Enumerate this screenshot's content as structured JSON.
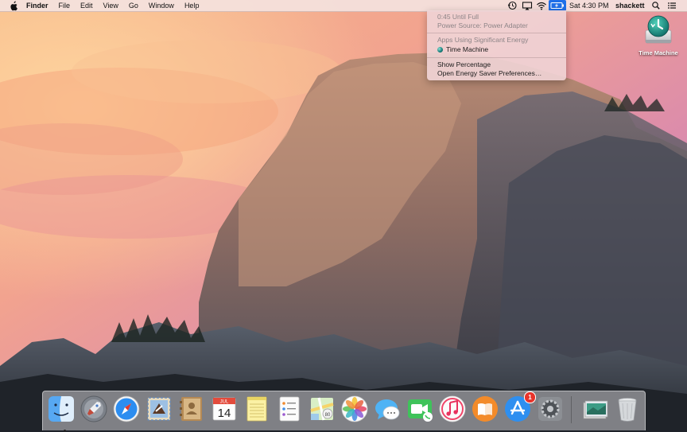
{
  "menubar": {
    "apple_icon": "apple-logo-icon",
    "app_name": "Finder",
    "menus": [
      "File",
      "Edit",
      "View",
      "Go",
      "Window",
      "Help"
    ],
    "status_icons": [
      "time-machine-icon",
      "airplay-icon",
      "wifi-icon",
      "battery-charging-icon"
    ],
    "clock": "Sat 4:30 PM",
    "user": "shackett",
    "right_icons": [
      "spotlight-search-icon",
      "notification-center-icon"
    ]
  },
  "battery_menu": {
    "time_remaining": "0:45 Until Full",
    "power_source": "Power Source: Power Adapter",
    "energy_header": "Apps Using Significant Energy",
    "energy_app": "Time Machine",
    "show_percentage": "Show Percentage",
    "energy_saver": "Open Energy Saver Preferences…"
  },
  "desktop": {
    "icon_label": "Time Machine",
    "icon": "time-machine-drive-icon"
  },
  "dock": {
    "apps": [
      {
        "name": "finder-icon",
        "running": true
      },
      {
        "name": "launchpad-icon"
      },
      {
        "name": "safari-icon"
      },
      {
        "name": "mail-icon"
      },
      {
        "name": "contacts-icon"
      },
      {
        "name": "calendar-icon",
        "month": "JUL",
        "day": "14"
      },
      {
        "name": "notes-icon"
      },
      {
        "name": "reminders-icon"
      },
      {
        "name": "maps-icon"
      },
      {
        "name": "photos-icon"
      },
      {
        "name": "messages-icon"
      },
      {
        "name": "facetime-icon"
      },
      {
        "name": "itunes-icon"
      },
      {
        "name": "ibooks-icon"
      },
      {
        "name": "app-store-icon",
        "badge": "1"
      },
      {
        "name": "system-preferences-icon"
      }
    ],
    "stacks": [
      "downloads-stack-icon",
      "trash-icon"
    ]
  },
  "colors": {
    "menu_highlight": "#1f6fe8",
    "badge": "#e8332a"
  }
}
